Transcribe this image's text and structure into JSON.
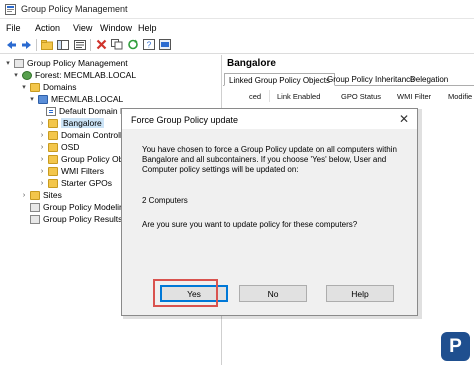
{
  "window": {
    "title": "Group Policy Management"
  },
  "menu": {
    "items": [
      "File",
      "Action",
      "View",
      "Window",
      "Help"
    ]
  },
  "tree": {
    "root": "Group Policy Management",
    "forest": "Forest: MECMLAB.LOCAL",
    "domains": "Domains",
    "domain": "MECMLAB.LOCAL",
    "default_policy": "Default Domain Policy",
    "bangalore": "Bangalore",
    "domain_controllers": "Domain Controll",
    "osd": "OSD",
    "gpo_objects": "Group Policy Ob",
    "wmi_filters": "WMI Filters",
    "starter_gpos": "Starter GPOs",
    "sites": "Sites",
    "modeling": "Group Policy Modeling",
    "results": "Group Policy Results"
  },
  "details": {
    "heading": "Bangalore",
    "tabs": [
      "Linked Group Policy Objects",
      "Group Policy Inheritance",
      "Delegation"
    ],
    "columns": [
      "ced",
      "Link Enabled",
      "GPO Status",
      "WMI Filter",
      "Modifie"
    ]
  },
  "dialog": {
    "title": "Force Group Policy update",
    "message": "You have chosen to force a Group Policy update on all computers within Bangalore and all subcontainers. If you choose 'Yes' below, User and Computer policy settings will be updated on:",
    "count": "2 Computers",
    "question": "Are you sure you want to update policy for these computers?",
    "buttons": {
      "yes": "Yes",
      "no": "No",
      "help": "Help"
    }
  },
  "colors": {
    "accent": "#0078d7",
    "highlight": "#d9534f",
    "selection": "#cce4f7"
  },
  "watermark": {
    "letter": "P"
  }
}
